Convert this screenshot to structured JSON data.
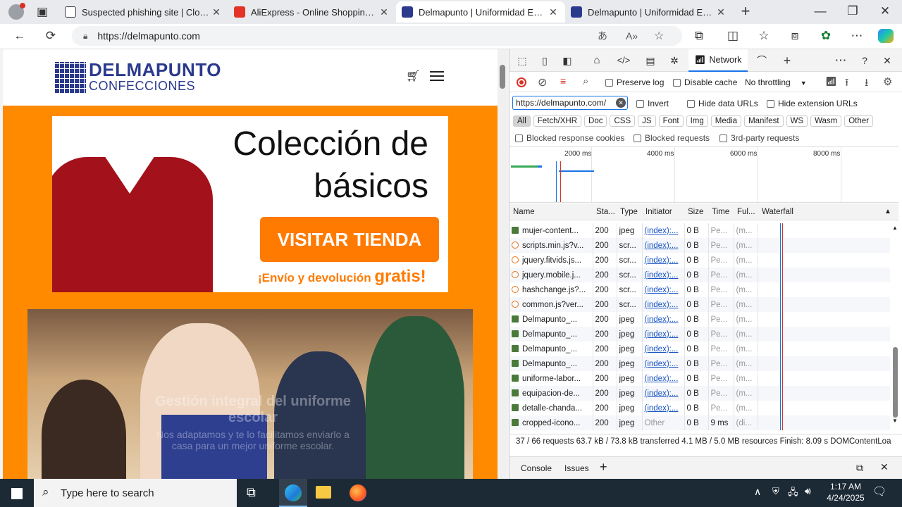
{
  "browser": {
    "tabs": [
      {
        "title": "Suspected phishing site | Cloudfla",
        "color": "#f38020"
      },
      {
        "title": "AliExpress - Online Shopping für P",
        "color": "#e43225"
      },
      {
        "title": "Delmapunto | Uniformidad Escolar",
        "color": "#2b3a8c"
      },
      {
        "title": "Delmapunto | Uniformidad Escolar",
        "color": "#2b3a8c"
      }
    ],
    "url": "https://delmapunto.com"
  },
  "site": {
    "brand": "DELMAPUNTO",
    "brand_sub": "CONFECCIONES",
    "banner": {
      "line1": "Colección de",
      "line2": "básicos",
      "button": "VISITAR TIENDA",
      "shipping": "¡Envío y devolución",
      "shipping_bold": "gratis!"
    },
    "overlay_line1": "Gestión integral del uniforme",
    "overlay_line2": "escolar",
    "overlay_line3": "Nos adaptamos y te lo facilitamos enviarlo a",
    "overlay_line4": "casa para un mejor uniforme escolar."
  },
  "devtools": {
    "network_tab": "Network",
    "preserve_log": "Preserve log",
    "disable_cache": "Disable cache",
    "throttling": "No throttling",
    "filter_value": "https://delmapunto.com/",
    "invert": "Invert",
    "hide_data_urls": "Hide data URLs",
    "hide_ext_urls": "Hide extension URLs",
    "type_filters": [
      "All",
      "Fetch/XHR",
      "Doc",
      "CSS",
      "JS",
      "Font",
      "Img",
      "Media",
      "Manifest",
      "WS",
      "Wasm",
      "Other"
    ],
    "blocked_cookies": "Blocked response cookies",
    "blocked_requests": "Blocked requests",
    "third_party": "3rd-party requests",
    "timeline_ticks": [
      "2000 ms",
      "4000 ms",
      "6000 ms",
      "8000 ms"
    ],
    "columns": [
      "Name",
      "Sta...",
      "Type",
      "Initiator",
      "Size",
      "Time",
      "Ful...",
      "Waterfall"
    ],
    "rows": [
      {
        "name": "mujer-content...",
        "status": "200",
        "type": "jpeg",
        "initiator": "(index):...",
        "size": "0 B",
        "time": "Pe...",
        "full": "(m...",
        "icon": "img"
      },
      {
        "name": "scripts.min.js?v...",
        "status": "200",
        "type": "scr...",
        "initiator": "(index):...",
        "size": "0 B",
        "time": "Pe...",
        "full": "(m...",
        "icon": "script"
      },
      {
        "name": "jquery.fitvids.js...",
        "status": "200",
        "type": "scr...",
        "initiator": "(index):...",
        "size": "0 B",
        "time": "Pe...",
        "full": "(m...",
        "icon": "script"
      },
      {
        "name": "jquery.mobile.j...",
        "status": "200",
        "type": "scr...",
        "initiator": "(index):...",
        "size": "0 B",
        "time": "Pe...",
        "full": "(m...",
        "icon": "script"
      },
      {
        "name": "hashchange.js?...",
        "status": "200",
        "type": "scr...",
        "initiator": "(index):...",
        "size": "0 B",
        "time": "Pe...",
        "full": "(m...",
        "icon": "script"
      },
      {
        "name": "common.js?ver...",
        "status": "200",
        "type": "scr...",
        "initiator": "(index):...",
        "size": "0 B",
        "time": "Pe...",
        "full": "(m...",
        "icon": "script"
      },
      {
        "name": "Delmapunto_...",
        "status": "200",
        "type": "jpeg",
        "initiator": "(index):...",
        "size": "0 B",
        "time": "Pe...",
        "full": "(m...",
        "icon": "img"
      },
      {
        "name": "Delmapunto_...",
        "status": "200",
        "type": "jpeg",
        "initiator": "(index):...",
        "size": "0 B",
        "time": "Pe...",
        "full": "(m...",
        "icon": "img"
      },
      {
        "name": "Delmapunto_...",
        "status": "200",
        "type": "jpeg",
        "initiator": "(index):...",
        "size": "0 B",
        "time": "Pe...",
        "full": "(m...",
        "icon": "img"
      },
      {
        "name": "Delmapunto_...",
        "status": "200",
        "type": "jpeg",
        "initiator": "(index):...",
        "size": "0 B",
        "time": "Pe...",
        "full": "(m...",
        "icon": "img"
      },
      {
        "name": "uniforme-labor...",
        "status": "200",
        "type": "jpeg",
        "initiator": "(index):...",
        "size": "0 B",
        "time": "Pe...",
        "full": "(m...",
        "icon": "img"
      },
      {
        "name": "equipacion-de...",
        "status": "200",
        "type": "jpeg",
        "initiator": "(index):...",
        "size": "0 B",
        "time": "Pe...",
        "full": "(m...",
        "icon": "img"
      },
      {
        "name": "detalle-chanda...",
        "status": "200",
        "type": "jpeg",
        "initiator": "(index):...",
        "size": "0 B",
        "time": "Pe...",
        "full": "(m...",
        "icon": "img"
      },
      {
        "name": "cropped-icono...",
        "status": "200",
        "type": "jpeg",
        "initiator": "Other",
        "size": "0 B",
        "time": "9 ms",
        "full": "(di...",
        "icon": "img"
      }
    ],
    "summary": "37 / 66 requests   63.7 kB / 73.8 kB transferred   4.1 MB / 5.0 MB resources   Finish: 8.09 s   DOMContentLoa",
    "drawer_tabs": [
      "Console",
      "Issues"
    ]
  },
  "taskbar": {
    "search_placeholder": "Type here to search",
    "time": "1:17 AM",
    "date": "4/24/2025"
  }
}
